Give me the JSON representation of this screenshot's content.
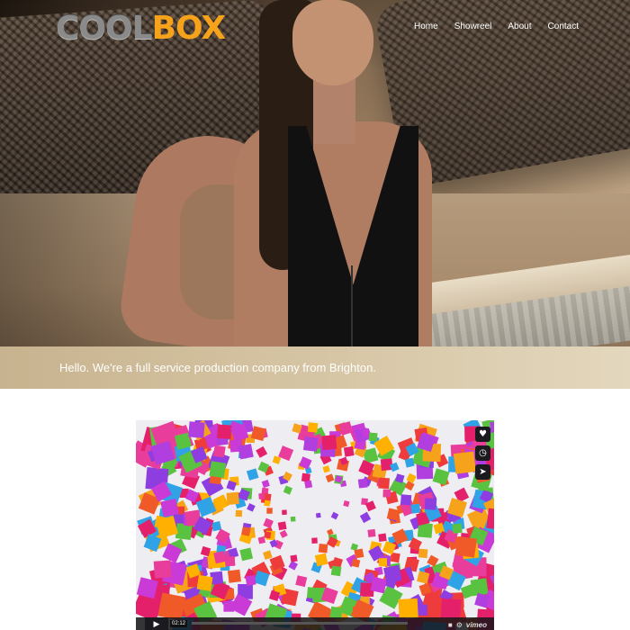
{
  "brand": {
    "logo_part1": "COOL",
    "logo_part2": "BOX",
    "accent_color": "#f7a21b"
  },
  "nav": {
    "items": [
      "Home",
      "Showreel",
      "About",
      "Contact"
    ]
  },
  "hero": {
    "tagline": "Hello. We're a full service production company from Brighton."
  },
  "video": {
    "timestamp": "02:12",
    "player_brand": "vimeo",
    "side_icons": [
      "heart-icon",
      "clock-icon",
      "send-icon"
    ]
  }
}
